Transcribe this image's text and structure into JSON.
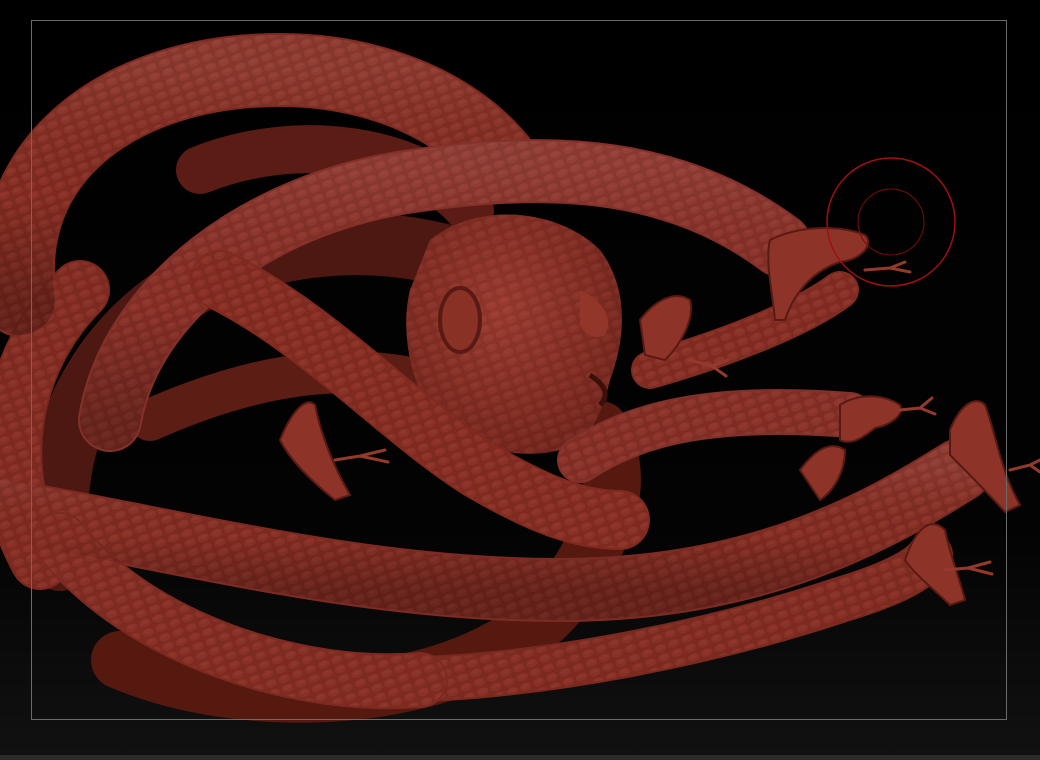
{
  "viewport": {
    "background": "#000000",
    "model": "medusa-snake-hair-sculpt",
    "material_color": "#8a2f24",
    "brush_cursor_color": "#a01010",
    "frame_color": "#6a6a6a"
  }
}
